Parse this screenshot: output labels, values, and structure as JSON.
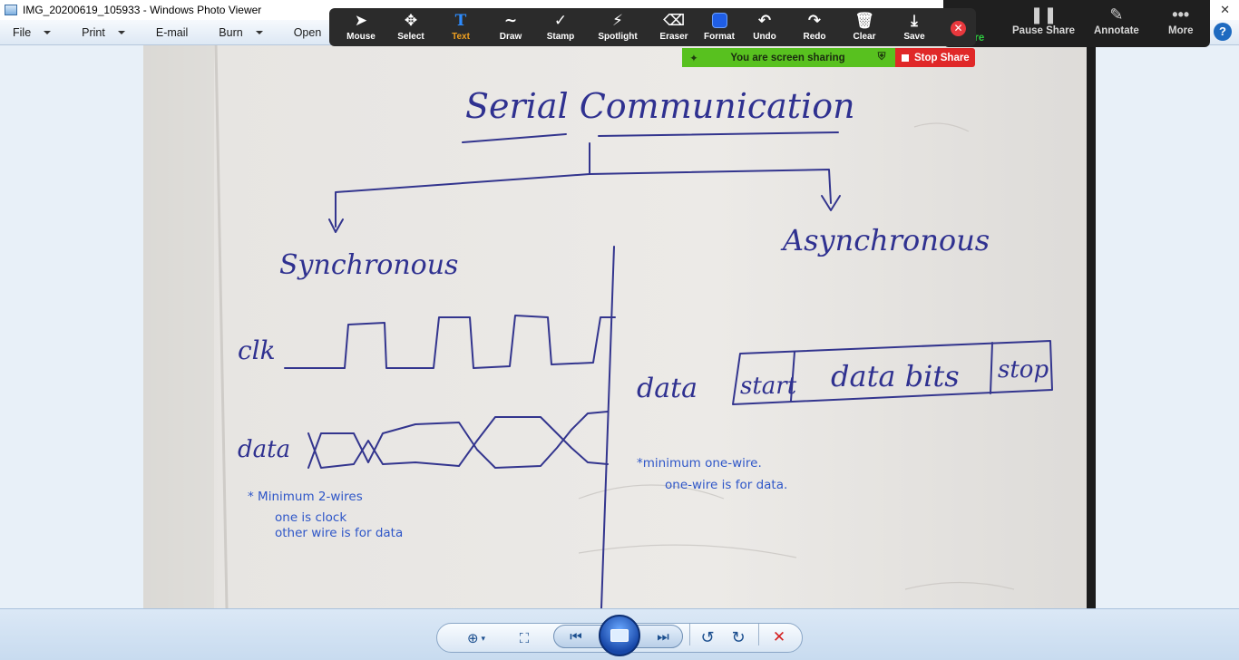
{
  "window": {
    "title": "IMG_20200619_105933 - Windows Photo Viewer",
    "close_glyph": "✕"
  },
  "menu": {
    "items": [
      {
        "label": "File",
        "has_dropdown": true
      },
      {
        "label": "Print",
        "has_dropdown": true
      },
      {
        "label": "E-mail",
        "has_dropdown": false
      },
      {
        "label": "Burn",
        "has_dropdown": true
      },
      {
        "label": "Open",
        "has_dropdown": true
      }
    ],
    "help_glyph": "?"
  },
  "annotate_toolbar": {
    "tools": [
      {
        "name": "mouse",
        "label": "Mouse",
        "glyph": "➤"
      },
      {
        "name": "select",
        "label": "Select",
        "glyph": "✥"
      },
      {
        "name": "text",
        "label": "Text",
        "glyph": "T",
        "active": true
      },
      {
        "name": "draw",
        "label": "Draw",
        "glyph": "∼"
      },
      {
        "name": "stamp",
        "label": "Stamp",
        "glyph": "✓"
      },
      {
        "name": "spotlight",
        "label": "Spotlight",
        "glyph": "⚡"
      },
      {
        "name": "eraser",
        "label": "Eraser",
        "glyph": "⌫"
      },
      {
        "name": "format",
        "label": "Format",
        "glyph": ""
      },
      {
        "name": "undo",
        "label": "Undo",
        "glyph": "↶"
      },
      {
        "name": "redo",
        "label": "Redo",
        "glyph": "↷"
      },
      {
        "name": "clear",
        "label": "Clear",
        "glyph": "🗑"
      },
      {
        "name": "save",
        "label": "Save",
        "glyph": "⤓"
      }
    ],
    "close_glyph": "✕",
    "format_color": "#1f5ee6"
  },
  "meeting_controls": {
    "share_partial": "are",
    "pause_share": {
      "label": "Pause Share",
      "glyph": "❚❚"
    },
    "annotate": {
      "label": "Annotate",
      "glyph": "✎"
    },
    "more": {
      "label": "More",
      "glyph": "•••"
    }
  },
  "sharing_banner": {
    "text": "You are screen sharing",
    "stop_label": "Stop Share"
  },
  "photo": {
    "handwriting": {
      "title": "Serial Communication",
      "left_branch": "Synchronous",
      "right_branch": "Asynchronous",
      "clk_label": "clk",
      "data_label_left": "data",
      "data_label_right": "data",
      "frame_start": "start",
      "frame_data": "data bits",
      "frame_stop": "stop"
    },
    "typed_notes": {
      "left_line1": "* Minimum 2-wires",
      "left_line2": "one is clock",
      "left_line3": "other wire is for data",
      "right_line1": "*minimum one-wire.",
      "right_line2": "one-wire is for data."
    }
  },
  "bottom_controls": {
    "zoom_glyph": "⊕",
    "fit_glyph": "⛶",
    "prev_glyph": "⏮",
    "next_glyph": "⏭",
    "rotate_ccw_glyph": "↺",
    "rotate_cw_glyph": "↻",
    "delete_glyph": "✕"
  }
}
